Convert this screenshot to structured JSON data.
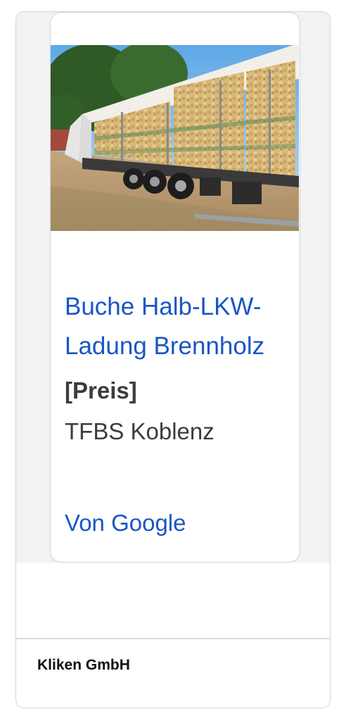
{
  "product": {
    "title": "Buche Halb-LKW-Ladung Brennholz",
    "price": "[Preis]",
    "seller": "TFBS Koblenz",
    "image_alt": "LKW-Anhänger mit Paletten Buchenbrennholz"
  },
  "footer": {
    "by_google": "Von Google",
    "advertiser": "Kliken GmbH"
  },
  "colors": {
    "link": "#1a56c4",
    "text": "#3c3c3c",
    "band": "#f1f2f4",
    "border": "#d3d3d3"
  }
}
